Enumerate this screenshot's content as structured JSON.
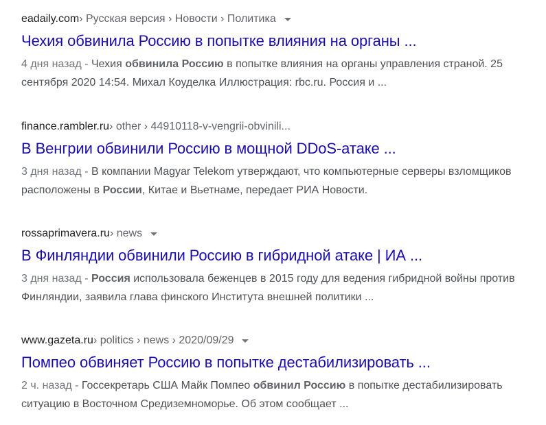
{
  "results": [
    {
      "domain": "eadaily.com",
      "path": " › Русская версия › Новости › Политика",
      "title": "Чехия обвинила Россию в попытке влияния на органы ...",
      "date": "4 дня назад - ",
      "snippet": [
        {
          "t": "Чехия ",
          "b": false
        },
        {
          "t": "обвинила Россию",
          "b": true
        },
        {
          "t": " в попытке влияния на органы управления страной. 25 сентября 2020 14:54. Михал Коуделка Иллюстрация: rbc.ru. Россия и ...",
          "b": false
        }
      ]
    },
    {
      "domain": "finance.rambler.ru",
      "path": " › other › 44910118-v-vengrii-obvinili...",
      "title": "В Венгрии обвинили Россию в мощной DDoS-атаке ...",
      "date": "3 дня назад - ",
      "snippet": [
        {
          "t": "В компании Magyar Telekom утверждают, что компьютерные серверы взломщиков расположены в ",
          "b": false
        },
        {
          "t": "России",
          "b": true
        },
        {
          "t": ", Китае и Вьетнаме, передает РИА Новости.",
          "b": false
        }
      ]
    },
    {
      "domain": "rossaprimavera.ru",
      "path": " › news",
      "title": "В Финляндии обвинили Россию в гибридной атаке | ИА ...",
      "date": "3 дня назад - ",
      "snippet": [
        {
          "t": "Россия",
          "b": true
        },
        {
          "t": " использовала беженцев в 2015 году для ведения гибридной войны против Финляндии, заявила глава финского Института внешней политики ...",
          "b": false
        }
      ]
    },
    {
      "domain": "www.gazeta.ru",
      "path": " › politics › news › 2020/09/29",
      "title": "Помпео обвиняет Россию в попытке дестабилизировать ...",
      "date": "2 ч. назад - ",
      "snippet": [
        {
          "t": "Госсекретарь США Майк Помпео ",
          "b": false
        },
        {
          "t": "обвинил Россию",
          "b": true
        },
        {
          "t": " в попытке дестабилизировать ситуацию в Восточном Средиземноморье. Об этом сообщает ...",
          "b": false
        }
      ]
    }
  ]
}
